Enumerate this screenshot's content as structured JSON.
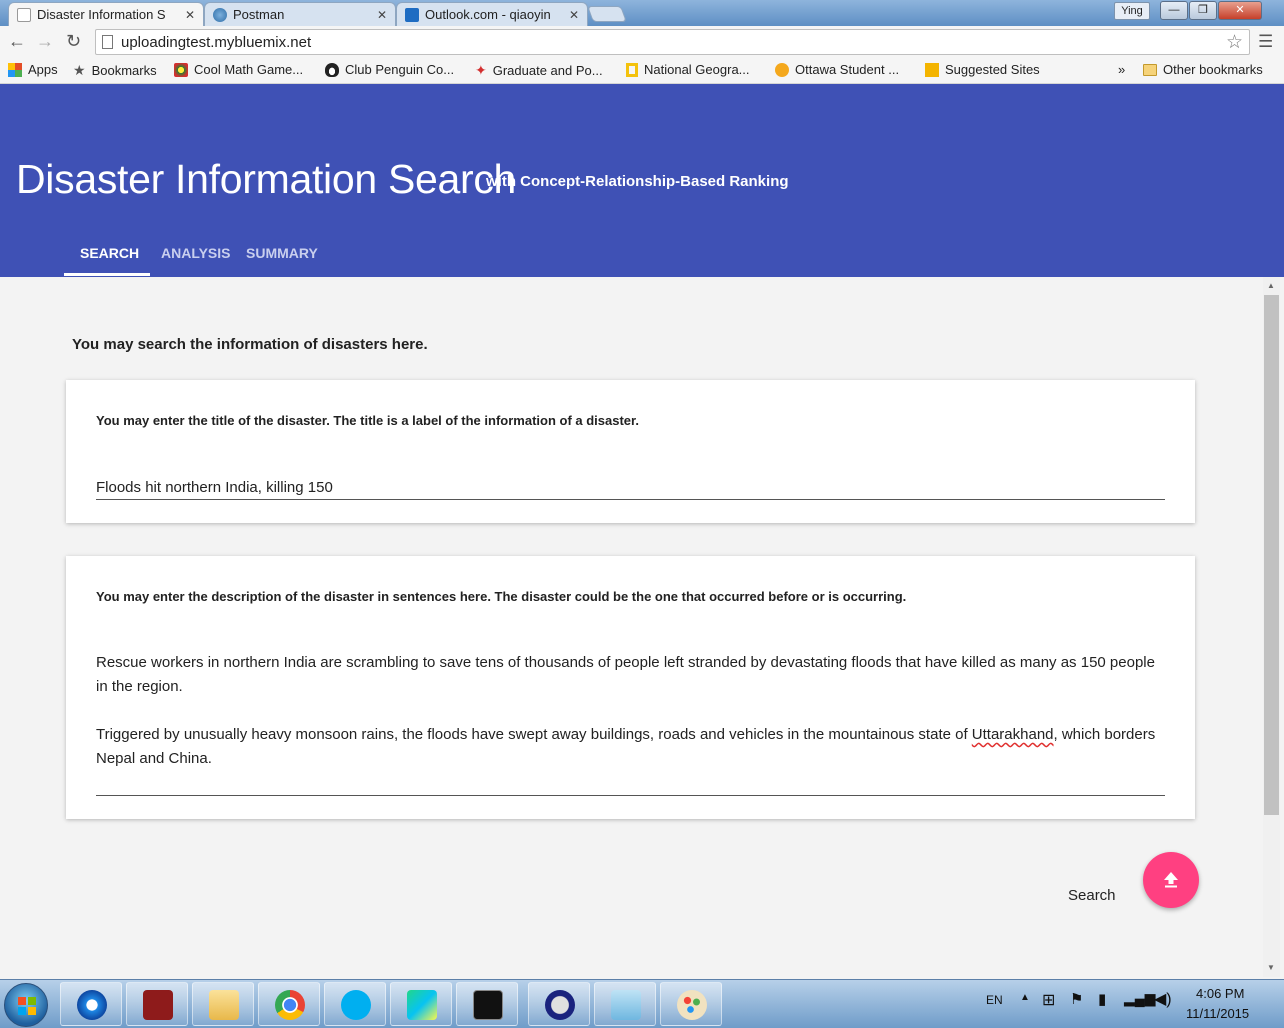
{
  "browser": {
    "tabs": [
      {
        "label": "Disaster Information S",
        "close": "✕"
      },
      {
        "label": "Postman",
        "close": "✕"
      },
      {
        "label": "Outlook.com - qiaoyin",
        "close": "✕"
      }
    ],
    "profile_name": "Ying",
    "window_controls": {
      "minimize": "—",
      "maximize": "❐",
      "close": "✕"
    },
    "url": "uploadingtest.mybluemix.net",
    "bookmarks": [
      {
        "label": "Apps",
        "icon": "apps-grid-icon",
        "color": "#e44d26"
      },
      {
        "label": "Bookmarks",
        "icon": "star-icon",
        "color": "#555555"
      },
      {
        "label": "Cool Math Game...",
        "icon": "coolmath-icon",
        "color": "#2e7d32"
      },
      {
        "label": "Club Penguin Co...",
        "icon": "penguin-icon",
        "color": "#333333"
      },
      {
        "label": "Graduate and Po...",
        "icon": "maple-leaf-icon",
        "color": "#d32f2f"
      },
      {
        "label": "National Geogra...",
        "icon": "natgeo-icon",
        "color": "#f4c20d"
      },
      {
        "label": "Ottawa Student ...",
        "icon": "smiley-icon",
        "color": "#f4a81d"
      },
      {
        "label": "Suggested Sites",
        "icon": "bing-icon",
        "color": "#f4b400"
      }
    ],
    "bookmarks_overflow": "»",
    "other_bookmarks": "Other bookmarks"
  },
  "app": {
    "title": "Disaster Information Search",
    "subtitle": "with Concept-Relationship-Based Ranking",
    "nav_tabs": [
      "SEARCH",
      "ANALYSIS",
      "SUMMARY"
    ],
    "active_tab": "SEARCH",
    "header_color": "#3f51b5",
    "accent_color": "#ff4081"
  },
  "search": {
    "intro": "You may search the information of disasters here.",
    "title_field": {
      "label": "You may enter the title of the disaster. The title is a label of the information of a disaster.",
      "value": "Floods hit northern India, killing 150"
    },
    "description_field": {
      "label": "You may enter the description of the disaster in sentences here. The disaster could be the one that occurred before or is occurring.",
      "paragraph1": "Rescue workers in northern India are scrambling to save tens of thousands of people left stranded by devastating floods that have killed as many as 150 people in the region.",
      "paragraph2_before": "Triggered by unusually heavy monsoon rains, the floods have swept away buildings, roads and vehicles in the mountainous state of ",
      "paragraph2_misspelled": "Uttarakhand",
      "paragraph2_after": ", which borders Nepal and China."
    },
    "search_label": "Search",
    "fab_icon": "upload-arrow-icon"
  },
  "taskbar": {
    "apps": [
      "internet-explorer-icon",
      "collins-dictionary-icon",
      "file-explorer-icon",
      "chrome-icon",
      "skype-icon",
      "webstorm-icon",
      "command-prompt-icon",
      "lock-app-icon",
      "notepad-icon",
      "paint-icon"
    ],
    "language": "EN",
    "time": "4:06 PM",
    "date": "11/11/2015"
  }
}
